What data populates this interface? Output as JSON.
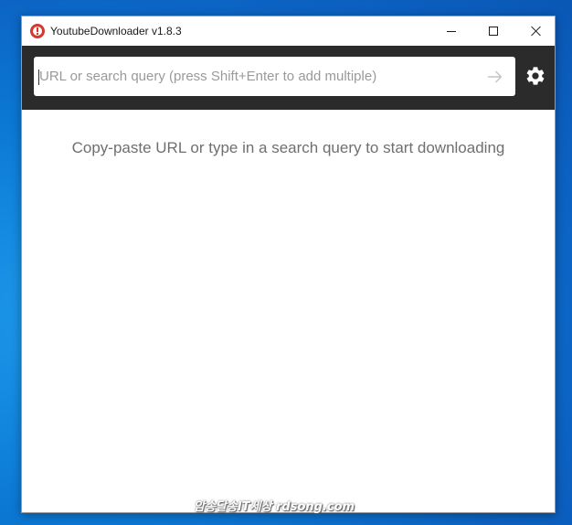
{
  "window": {
    "title": "YoutubeDownloader v1.8.3",
    "icon": "app-logo-icon"
  },
  "titlebar_buttons": {
    "minimize": "minimize-icon",
    "maximize": "maximize-icon",
    "close": "close-icon"
  },
  "search": {
    "placeholder": "URL or search query (press Shift+Enter to add multiple)",
    "value": "",
    "submit_icon": "arrow-right-icon"
  },
  "settings": {
    "icon": "gear-icon"
  },
  "main": {
    "hint": "Copy-paste URL or type in a search query to start downloading"
  },
  "watermark": {
    "text": "암송달송IT세상 rdsong.com"
  },
  "colors": {
    "toolbar_bg": "#2b2b2b",
    "desktop_bg": "#0b78d4",
    "hint_text": "#6f6f6f",
    "placeholder_text": "#9a9a9a"
  }
}
